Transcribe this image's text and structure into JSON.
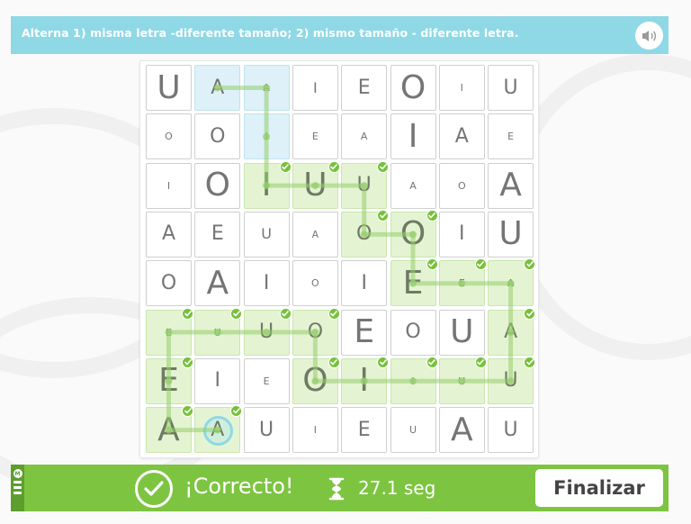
{
  "instruction": "Alterna 1) misma letra -diferente tamaño; 2) mismo tamaño - diferente letra.",
  "colors": {
    "accent_blue": "#8fd8e6",
    "accent_green": "#7dc441",
    "check_green": "#77c13b",
    "cell_green": "#e4f4d2",
    "cell_blue": "#def1f8"
  },
  "icons": {
    "sound": "speaker-icon",
    "result": "check-circle-icon",
    "timer": "hourglass-icon",
    "cell_check": "check-icon"
  },
  "board": {
    "rows": [
      [
        {
          "l": "U",
          "s": "l"
        },
        {
          "l": "A",
          "s": "m",
          "st": "blue"
        },
        {
          "l": "A",
          "s": "xs",
          "st": "blue"
        },
        {
          "l": "I",
          "s": "s"
        },
        {
          "l": "E",
          "s": "m"
        },
        {
          "l": "O",
          "s": "l"
        },
        {
          "l": "I",
          "s": "xs"
        },
        {
          "l": "U",
          "s": "m"
        }
      ],
      [
        {
          "l": "O",
          "s": "xs"
        },
        {
          "l": "O",
          "s": "m"
        },
        {
          "l": "I",
          "s": "xs",
          "st": "blue"
        },
        {
          "l": "E",
          "s": "xs"
        },
        {
          "l": "A",
          "s": "xs"
        },
        {
          "l": "I",
          "s": "l"
        },
        {
          "l": "A",
          "s": "m"
        },
        {
          "l": "E",
          "s": "xs"
        }
      ],
      [
        {
          "l": "I",
          "s": "xs"
        },
        {
          "l": "O",
          "s": "l"
        },
        {
          "l": "I",
          "s": "l",
          "st": "green",
          "ok": true
        },
        {
          "l": "U",
          "s": "l",
          "st": "green",
          "ok": true
        },
        {
          "l": "U",
          "s": "m",
          "st": "green",
          "ok": true
        },
        {
          "l": "A",
          "s": "xs"
        },
        {
          "l": "O",
          "s": "xs"
        },
        {
          "l": "A",
          "s": "l"
        }
      ],
      [
        {
          "l": "A",
          "s": "m"
        },
        {
          "l": "E",
          "s": "m"
        },
        {
          "l": "U",
          "s": "s"
        },
        {
          "l": "A",
          "s": "xs"
        },
        {
          "l": "O",
          "s": "m",
          "st": "green",
          "ok": true
        },
        {
          "l": "O",
          "s": "l",
          "st": "green",
          "ok": true
        },
        {
          "l": "I",
          "s": "m"
        },
        {
          "l": "U",
          "s": "l"
        }
      ],
      [
        {
          "l": "O",
          "s": "m"
        },
        {
          "l": "A",
          "s": "l"
        },
        {
          "l": "I",
          "s": "m"
        },
        {
          "l": "O",
          "s": "xs"
        },
        {
          "l": "I",
          "s": "m"
        },
        {
          "l": "E",
          "s": "l",
          "st": "green",
          "ok": true
        },
        {
          "l": "E",
          "s": "xs",
          "st": "green",
          "ok": true
        },
        {
          "l": "A",
          "s": "xs",
          "st": "green",
          "ok": true
        }
      ],
      [
        {
          "l": "E",
          "s": "xs",
          "st": "green",
          "ok": true
        },
        {
          "l": "U",
          "s": "xs",
          "st": "green",
          "ok": true
        },
        {
          "l": "U",
          "s": "m",
          "st": "green",
          "ok": true
        },
        {
          "l": "O",
          "s": "m",
          "st": "green",
          "ok": true
        },
        {
          "l": "E",
          "s": "l"
        },
        {
          "l": "O",
          "s": "m"
        },
        {
          "l": "U",
          "s": "l"
        },
        {
          "l": "A",
          "s": "m",
          "st": "green",
          "ok": true
        }
      ],
      [
        {
          "l": "E",
          "s": "l",
          "st": "green",
          "ok": true
        },
        {
          "l": "I",
          "s": "m"
        },
        {
          "l": "E",
          "s": "xs"
        },
        {
          "l": "O",
          "s": "l",
          "st": "green",
          "ok": true
        },
        {
          "l": "I",
          "s": "l",
          "st": "green",
          "ok": true
        },
        {
          "l": "I",
          "s": "xs",
          "st": "green",
          "ok": true
        },
        {
          "l": "U",
          "s": "xs",
          "st": "green",
          "ok": true
        },
        {
          "l": "U",
          "s": "m",
          "st": "green",
          "ok": true
        }
      ],
      [
        {
          "l": "A",
          "s": "l",
          "st": "green",
          "ok": true
        },
        {
          "l": "A",
          "s": "m",
          "st": "green",
          "ok": true,
          "cur": true
        },
        {
          "l": "U",
          "s": "m"
        },
        {
          "l": "I",
          "s": "xs"
        },
        {
          "l": "E",
          "s": "m"
        },
        {
          "l": "U",
          "s": "xs"
        },
        {
          "l": "A",
          "s": "l"
        },
        {
          "l": "U",
          "s": "m"
        }
      ]
    ],
    "path_cells": [
      [
        0,
        1
      ],
      [
        0,
        2
      ],
      [
        1,
        2
      ],
      [
        2,
        2
      ],
      [
        2,
        3
      ],
      [
        2,
        4
      ],
      [
        3,
        4
      ],
      [
        3,
        5
      ],
      [
        4,
        5
      ],
      [
        4,
        6
      ],
      [
        4,
        7
      ],
      [
        5,
        7
      ],
      [
        6,
        7
      ],
      [
        6,
        6
      ],
      [
        6,
        5
      ],
      [
        6,
        4
      ],
      [
        6,
        3
      ],
      [
        5,
        3
      ],
      [
        5,
        2
      ],
      [
        5,
        1
      ],
      [
        5,
        0
      ],
      [
        6,
        0
      ],
      [
        7,
        0
      ],
      [
        7,
        1
      ]
    ]
  },
  "footer": {
    "result_label": "¡Correcto!",
    "time_label": "27.1 seg",
    "finish_label": "Finalizar",
    "logo_letter": "M"
  }
}
